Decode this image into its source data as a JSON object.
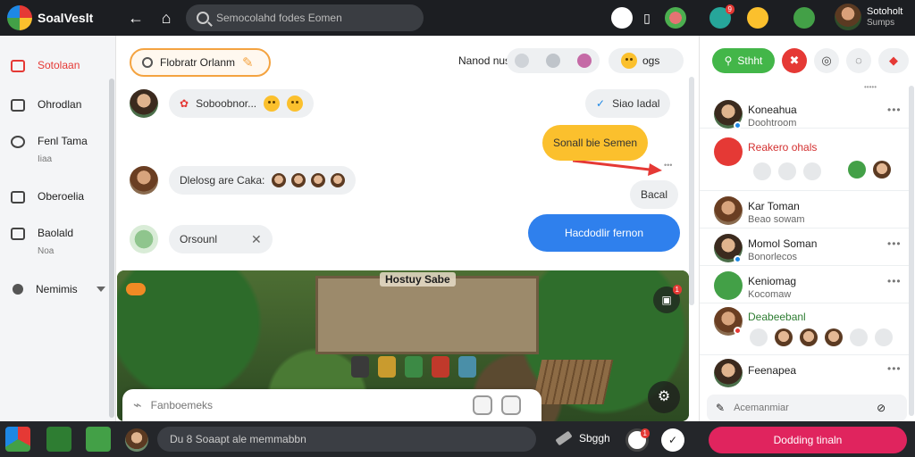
{
  "app": {
    "title": "SoalVeslt"
  },
  "topbar": {
    "search_placeholder": "Semocolahd fodes Eomen",
    "user_name": "Sotoholt",
    "user_sub": "Sumps",
    "notif_count": "9",
    "icons": [
      "back-arrow-icon",
      "cat-icon",
      "search-icon",
      "clock-icon",
      "phone-icon",
      "avatar-icon",
      "heart-icon",
      "coin-icon",
      "chat-icon"
    ]
  },
  "sidebar": {
    "items": [
      {
        "label": "Sotolaan",
        "sub": "",
        "icon": "inbox-icon"
      },
      {
        "label": "Ohrodlan",
        "sub": "",
        "icon": "chat-icon"
      },
      {
        "label": "Fenl Tama",
        "sub": "Iiaa",
        "icon": "search-icon"
      },
      {
        "label": "Oberoelia",
        "sub": "",
        "icon": "folder-icon"
      },
      {
        "label": "Baolald",
        "sub": "Noa",
        "icon": "image-icon"
      },
      {
        "label": "Nemimis",
        "sub": "",
        "icon": "globe-icon"
      }
    ]
  },
  "chat": {
    "pinned": "Flobratr Orlanm",
    "header_text": "Nanod nus",
    "header_tag": "ogs",
    "messages": [
      {
        "side": "left",
        "text": "Soboobnor..."
      },
      {
        "side": "right",
        "text": "Siao Iadal"
      },
      {
        "side": "right",
        "text": "Sonall  bie  Semen",
        "highlight": true
      },
      {
        "side": "left",
        "text": "Dlelosg are Caka:"
      },
      {
        "side": "right",
        "text": "Bacal"
      },
      {
        "side": "left",
        "text": "Orsounl"
      },
      {
        "side": "right",
        "text": "Hacdodlir fernon"
      }
    ]
  },
  "game": {
    "title": "Hostuy Sabe",
    "notif_count": "1"
  },
  "compose": {
    "placeholder": "Fanboemeks"
  },
  "right": {
    "primary_label": "Sthht",
    "note": "•••••",
    "contacts": [
      {
        "name": "Koneahua",
        "sub": "Doohtroom"
      },
      {
        "name": "Reakero ohals",
        "sub": ""
      },
      {
        "name": "Kar Toman",
        "sub": "Beao sowam"
      },
      {
        "name": "Momol Soman",
        "sub": "Bonorlecos"
      },
      {
        "name": "Keniomag",
        "sub": "Kocomaw"
      },
      {
        "name": "Deabeebanl",
        "sub": ""
      },
      {
        "name": "Feenapea",
        "sub": ""
      }
    ],
    "compose_placeholder": "Acemanmiar"
  },
  "bottombar": {
    "input_placeholder": "Du 8 Soaapt ale memmabbn",
    "tool_label": "Sbggh",
    "notif_count": "1",
    "cta_label": "Dodding tinaln"
  },
  "colors": {
    "accent_green": "#43b649",
    "accent_yellow": "#fbc02d",
    "accent_blue": "#2f80ed",
    "accent_red": "#e53935",
    "cta_pink": "#e0245e"
  }
}
